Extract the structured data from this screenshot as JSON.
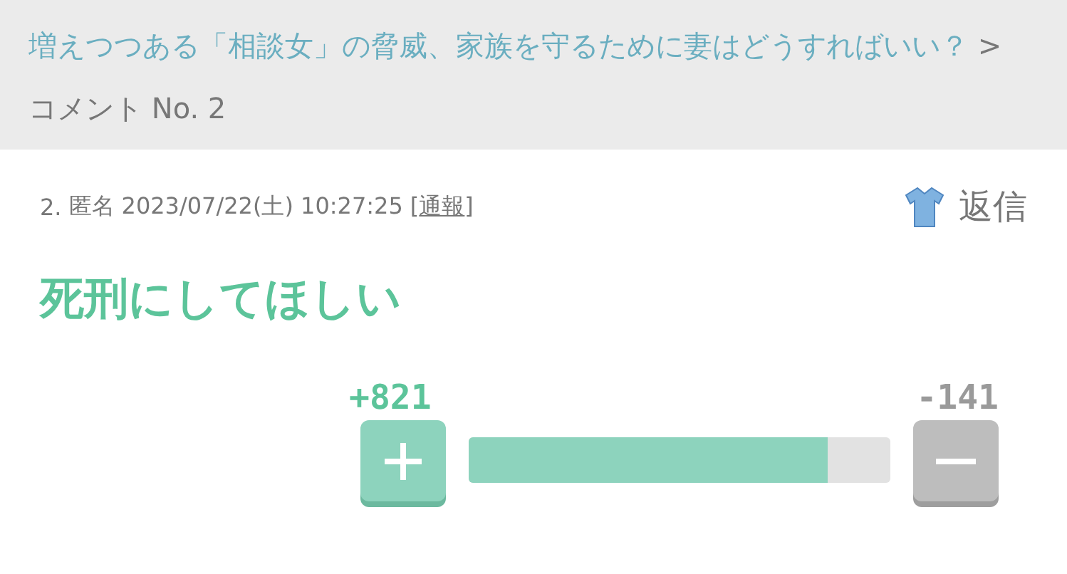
{
  "breadcrumb": {
    "topic_link": "増えつつある「相談女」の脅威、家族を守るために妻はどうすればいい？",
    "separator": ">",
    "current": "コメント No. 2"
  },
  "comment": {
    "number": "2.",
    "author": "匿名",
    "datetime": "2023/07/22(土) 10:27:25",
    "report_open": "[",
    "report_link": "通報",
    "report_close": "]",
    "reply": "返信",
    "body": "死刑にしてほしい"
  },
  "votes": {
    "plus_count": "+821",
    "minus_count": "-141",
    "level": 0.85
  }
}
